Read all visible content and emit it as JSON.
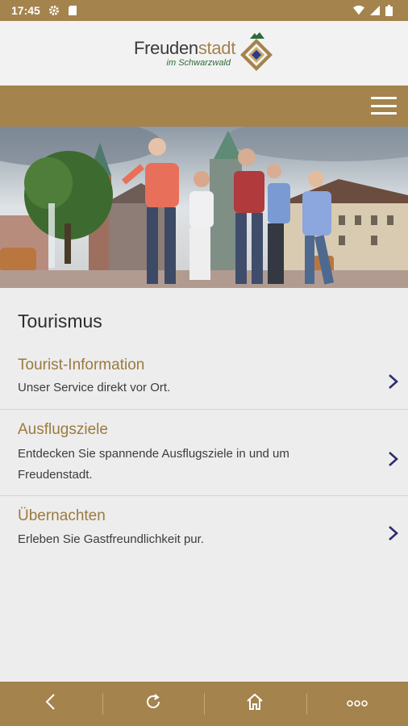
{
  "status_bar": {
    "time": "17:45",
    "icons": [
      "gear-icon",
      "sd-card-icon",
      "wifi-icon",
      "signal-icon",
      "battery-icon"
    ]
  },
  "header": {
    "logo_main_part1": "Freuden",
    "logo_main_part2": "stadt",
    "logo_sub": "im Schwarzwald"
  },
  "toolbar": {
    "menu_icon": "hamburger-icon"
  },
  "hero": {
    "description_icon": "photo-people-walking-town-square"
  },
  "main": {
    "section_title": "Tourismus",
    "items": [
      {
        "title": "Tourist-Information",
        "desc": "Unser Service direkt vor Ort."
      },
      {
        "title": "Ausflugsziele",
        "desc": "Entdecken Sie spannende Ausflugsziele in und um Freudenstadt."
      },
      {
        "title": "Übernachten",
        "desc": "Erleben Sie Gastfreundlichkeit pur."
      }
    ]
  },
  "bottom_nav": {
    "icons": [
      "back-icon",
      "refresh-icon",
      "home-icon",
      "more-icon"
    ]
  },
  "colors": {
    "brand_gold": "#a4834d",
    "title_gold": "#9b7a3f",
    "chevron_navy": "#2b2d6e",
    "background": "#ededed",
    "logo_green": "#2c6b3a"
  }
}
